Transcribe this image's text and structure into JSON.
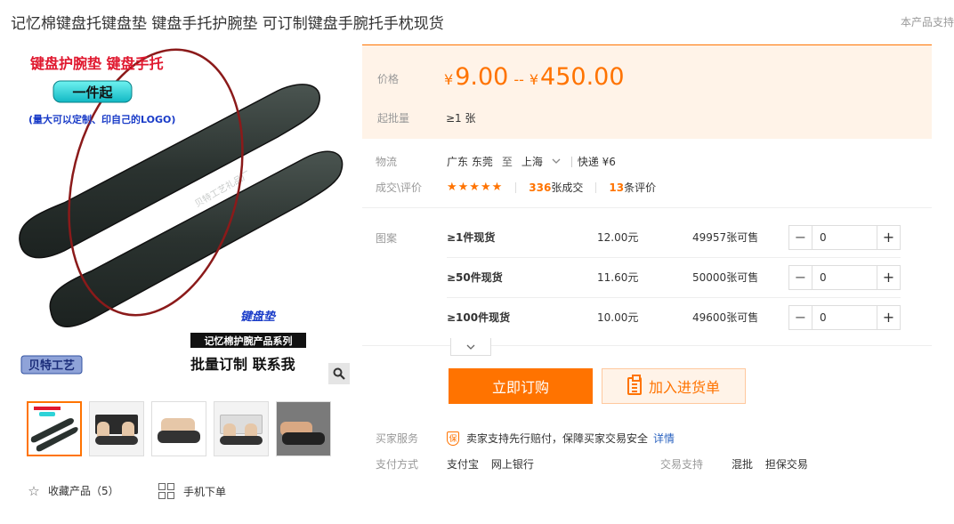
{
  "title": "记忆棉键盘托键盘垫 键盘手托护腕垫 可订制键盘手腕托手枕现货",
  "corner_link": "本产品支持",
  "image": {
    "banner_top": "键盘护腕垫 键盘手托",
    "badge": "一件起",
    "custom_note": "(量大可以定制、印自己的LOGO)",
    "pad_print": "贝特工艺礼品厂",
    "script_logo": "键盘垫",
    "series_label": "记忆棉护腕产品系列",
    "bottom_slogan": "批量订制 联系我",
    "brand": "贝特工艺"
  },
  "favorites": {
    "label": "收藏产品",
    "count": "（5）"
  },
  "mobile": {
    "label": "手机下单"
  },
  "price": {
    "label": "价格",
    "currency": "¥",
    "min": "9.00",
    "separator": "--",
    "max": "450.00"
  },
  "moq": {
    "label": "起批量",
    "value": "≥1 张"
  },
  "shipping": {
    "label": "物流",
    "from": "广东 东莞",
    "to_word": "至",
    "dest": "上海",
    "method": "快递 ¥6"
  },
  "deals": {
    "label": "成交\\评价",
    "stars": "★★★★★",
    "sold_count": "336",
    "sold_suffix": "张成交",
    "review_count": "13",
    "review_suffix": "条评价"
  },
  "specs": {
    "label": "图案",
    "rows": [
      {
        "name": "≥1件现货",
        "price": "12.00元",
        "stock_num": "49957",
        "stock_suffix": "张可售",
        "qty": "0"
      },
      {
        "name": "≥50件现货",
        "price": "11.60元",
        "stock_num": "50000",
        "stock_suffix": "张可售",
        "qty": "0"
      },
      {
        "name": "≥100件现货",
        "price": "10.00元",
        "stock_num": "49600",
        "stock_suffix": "张可售",
        "qty": "0"
      }
    ]
  },
  "buttons": {
    "buy": "立即订购",
    "cart": "加入进货单"
  },
  "service": {
    "label": "买家服务",
    "badge": "保",
    "text": "卖家支持先行赔付，保障买家交易安全",
    "link": "详情"
  },
  "payment": {
    "label": "支付方式",
    "methods": [
      "支付宝",
      "网上银行"
    ]
  },
  "trade": {
    "label": "交易支持",
    "options": [
      "混批",
      "担保交易"
    ]
  },
  "colors": {
    "accent": "#ff7300",
    "price_bg": "#fff3e8",
    "link": "#2b63c0"
  }
}
